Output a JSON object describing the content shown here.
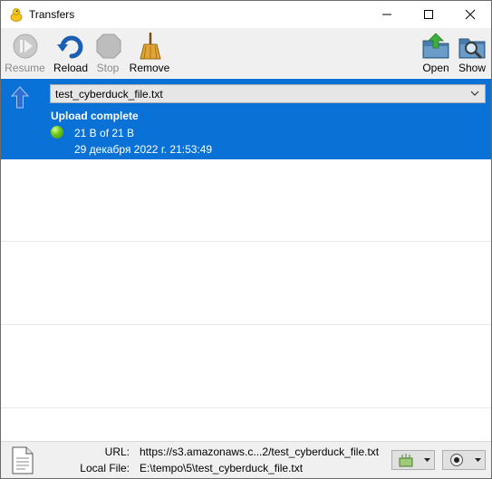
{
  "window": {
    "title": "Transfers"
  },
  "toolbar": {
    "resume": "Resume",
    "reload": "Reload",
    "stop": "Stop",
    "remove": "Remove",
    "open": "Open",
    "show": "Show"
  },
  "transfer": {
    "filename": "test_cyberduck_file.txt",
    "status": "Upload complete",
    "progress": "21 B of 21 B",
    "date": "29 декабря 2022 г. 21:53:49"
  },
  "footer": {
    "url_label": "URL:",
    "url_value": "https://s3.amazonaws.c...2/test_cyberduck_file.txt",
    "local_label": "Local File:",
    "local_value": "E:\\tempo\\5\\test_cyberduck_file.txt"
  },
  "colors": {
    "selection": "#0a72d6",
    "toolbar_bg": "#f0f0f0"
  }
}
